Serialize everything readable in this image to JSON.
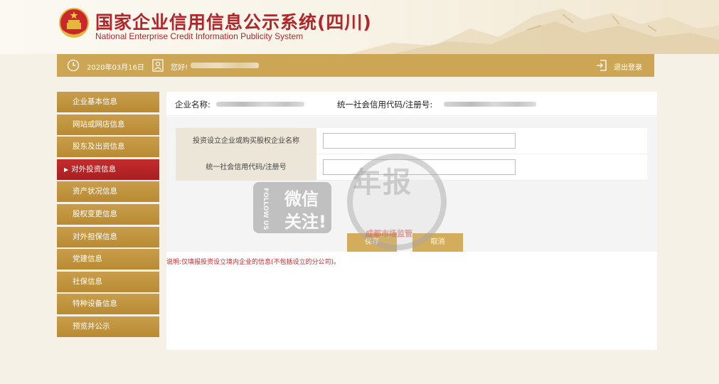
{
  "header": {
    "title": "国家企业信用信息公示系统(四川)",
    "subtitle": "National Enterprise Credit Information Publicity System"
  },
  "topbar": {
    "date": "2020年03月16日",
    "greeting": "您好!",
    "logout": "退出登录"
  },
  "sidebar": {
    "items": [
      {
        "label": "企业基本信息"
      },
      {
        "label": "网站或网店信息"
      },
      {
        "label": "股东及出资信息"
      },
      {
        "label": "对外投资信息"
      },
      {
        "label": "资产状况信息"
      },
      {
        "label": "股权变更信息"
      },
      {
        "label": "对外担保信息"
      },
      {
        "label": "党建信息"
      },
      {
        "label": "社保信息"
      },
      {
        "label": "特种设备信息"
      },
      {
        "label": "预览并公示"
      }
    ],
    "active_index": 3,
    "active_marker": "▶"
  },
  "main": {
    "company_name_label": "企业名称:",
    "credit_code_label": "统一社会信用代码/注册号:",
    "form": {
      "field1_label": "投资设立企业或购买股权企业名称",
      "field1_value": "",
      "field2_label": "统一社会信用代码/注册号",
      "field2_value": ""
    },
    "save_label": "保存",
    "cancel_label": "取消",
    "note": "说明:仅填报投资设立境内企业的信息(不包括设立的分公司)。"
  },
  "watermark": {
    "follow": "FOLLOW US",
    "line1": "微信",
    "line2": "关注!",
    "big": "年报",
    "bottom": "成都市场监管"
  },
  "colors": {
    "brand_red": "#b1262a",
    "gold": "#cda655",
    "active_red": "#b82426"
  }
}
